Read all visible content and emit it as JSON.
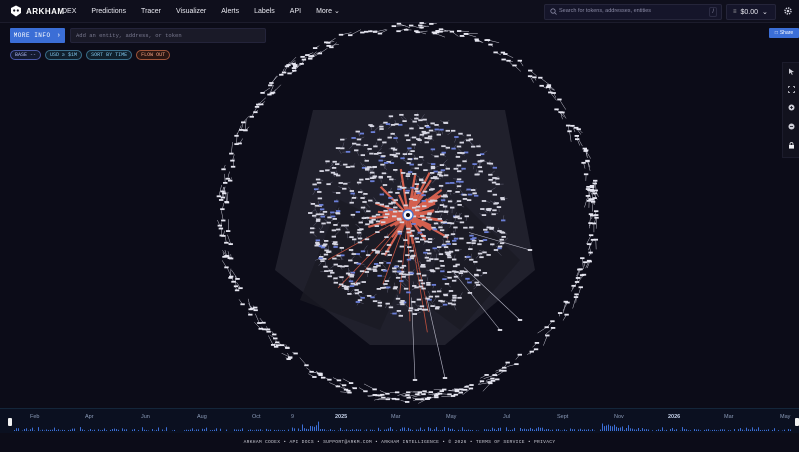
{
  "app": {
    "brand": "ARKHAM"
  },
  "nav": {
    "items": [
      "DEX",
      "Predictions",
      "Tracer",
      "Visualizer",
      "Alerts",
      "Labels",
      "API"
    ],
    "more": "More"
  },
  "search": {
    "placeholder": "Search for tokens, addresses, entities",
    "shortcut": "/"
  },
  "wallet": {
    "balance": "$0.00"
  },
  "actions": {
    "more_info": "MORE INFO",
    "share": "Share"
  },
  "entity_input": {
    "placeholder": "Add an entity, address, or token"
  },
  "filters": {
    "base": "BASE",
    "base_value": "--",
    "usd": "USD ≥ $1M",
    "sort": "SORT BY TIME",
    "flow": "FLOW OUT"
  },
  "toolbar": {
    "icons": [
      "cursor-icon",
      "fullscreen-icon",
      "zoom-in-icon",
      "zoom-out-icon",
      "lock-icon"
    ]
  },
  "timeline": {
    "labels": [
      {
        "text": "Feb",
        "bold": false
      },
      {
        "text": "Apr",
        "bold": false
      },
      {
        "text": "Jun",
        "bold": false
      },
      {
        "text": "Aug",
        "bold": false
      },
      {
        "text": "Oct",
        "bold": false
      },
      {
        "text": "9",
        "bold": false
      },
      {
        "text": "2025",
        "bold": true
      },
      {
        "text": "Mar",
        "bold": false
      },
      {
        "text": "May",
        "bold": false
      },
      {
        "text": "Jul",
        "bold": false
      },
      {
        "text": "Sept",
        "bold": false
      },
      {
        "text": "Nov",
        "bold": false
      },
      {
        "text": "2026",
        "bold": true
      },
      {
        "text": "Mar",
        "bold": false
      },
      {
        "text": "May",
        "bold": false
      }
    ]
  },
  "footer": {
    "text": "ARKHAM CODEX • API DOCS • SUPPORT@ARKM.COM • ARKHAM INTELLIGENCE • © 2026 • TERMS OF SERVICE • PRIVACY"
  },
  "colors": {
    "accent": "#3b6ed6",
    "flow": "#d4604f",
    "background": "#0c0c18"
  }
}
